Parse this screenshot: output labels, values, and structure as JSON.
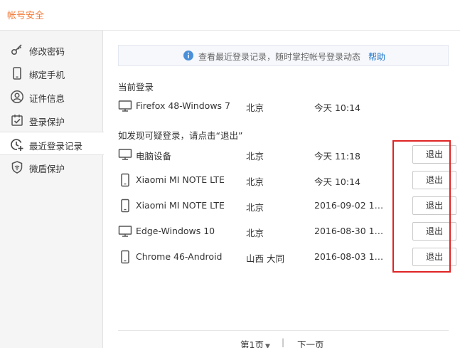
{
  "header": {
    "title": "帐号安全"
  },
  "colors": {
    "accent": "#f27b3a",
    "link": "#1a73c9",
    "highlight": "#e02424",
    "info": "#4a90d9"
  },
  "sidebar": {
    "items": [
      {
        "label": "修改密码",
        "icon": "key-icon"
      },
      {
        "label": "绑定手机",
        "icon": "phone-icon"
      },
      {
        "label": "证件信息",
        "icon": "user-icon"
      },
      {
        "label": "登录保护",
        "icon": "shield-check-icon"
      },
      {
        "label": "最近登录记录",
        "icon": "clock-plus-icon",
        "active": true
      },
      {
        "label": "微盾保护",
        "icon": "micro-shield-icon"
      }
    ]
  },
  "tip": {
    "text": "查看最近登录记录，随时掌控帐号登录动态",
    "help": "帮助"
  },
  "current": {
    "label": "当前登录",
    "row": {
      "device": "Firefox 48-Windows 7",
      "location": "北京",
      "time": "今天 10:14",
      "icon": "monitor-icon"
    }
  },
  "suspicious": {
    "label": "如发现可疑登录，请点击“退出”",
    "logout_label": "退出",
    "rows": [
      {
        "device": "电脑设备",
        "location": "北京",
        "time": "今天 11:18",
        "icon": "monitor-icon"
      },
      {
        "device": "Xiaomi MI NOTE LTE",
        "location": "北京",
        "time": "今天 10:14",
        "icon": "mobile-icon"
      },
      {
        "device": "Xiaomi MI NOTE LTE",
        "location": "北京",
        "time": "2016-09-02 17:...",
        "icon": "mobile-icon"
      },
      {
        "device": "Edge-Windows 10",
        "location": "北京",
        "time": "2016-08-30 16:...",
        "icon": "monitor-icon"
      },
      {
        "device": "Chrome 46-Android",
        "location": "山西 大同",
        "time": "2016-08-03 17:...",
        "icon": "mobile-icon"
      }
    ]
  },
  "pager": {
    "current": "第1页",
    "separator": "|",
    "next": "下一页"
  }
}
